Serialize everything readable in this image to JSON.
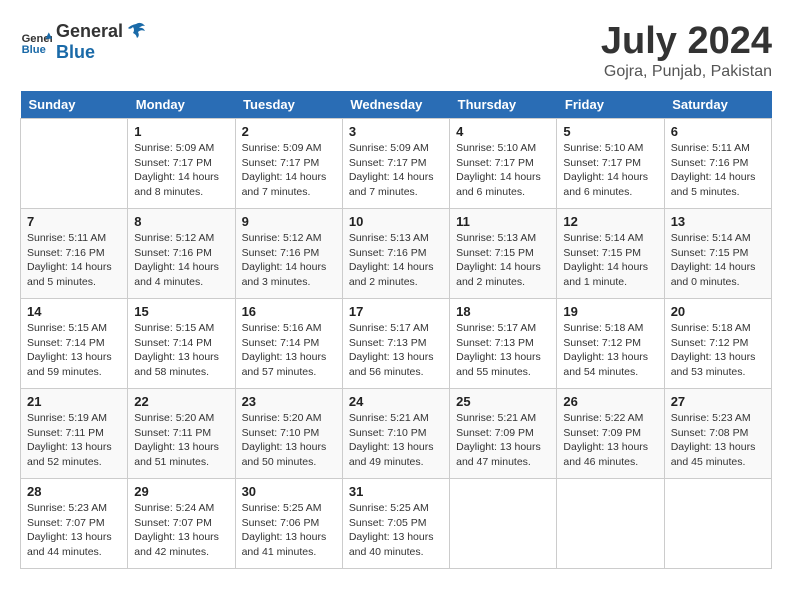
{
  "header": {
    "logo_general": "General",
    "logo_blue": "Blue",
    "title": "July 2024",
    "subtitle": "Gojra, Punjab, Pakistan"
  },
  "calendar": {
    "days_of_week": [
      "Sunday",
      "Monday",
      "Tuesday",
      "Wednesday",
      "Thursday",
      "Friday",
      "Saturday"
    ],
    "weeks": [
      [
        {
          "date": "",
          "info": ""
        },
        {
          "date": "1",
          "info": "Sunrise: 5:09 AM\nSunset: 7:17 PM\nDaylight: 14 hours\nand 8 minutes."
        },
        {
          "date": "2",
          "info": "Sunrise: 5:09 AM\nSunset: 7:17 PM\nDaylight: 14 hours\nand 7 minutes."
        },
        {
          "date": "3",
          "info": "Sunrise: 5:09 AM\nSunset: 7:17 PM\nDaylight: 14 hours\nand 7 minutes."
        },
        {
          "date": "4",
          "info": "Sunrise: 5:10 AM\nSunset: 7:17 PM\nDaylight: 14 hours\nand 6 minutes."
        },
        {
          "date": "5",
          "info": "Sunrise: 5:10 AM\nSunset: 7:17 PM\nDaylight: 14 hours\nand 6 minutes."
        },
        {
          "date": "6",
          "info": "Sunrise: 5:11 AM\nSunset: 7:16 PM\nDaylight: 14 hours\nand 5 minutes."
        }
      ],
      [
        {
          "date": "7",
          "info": "Sunrise: 5:11 AM\nSunset: 7:16 PM\nDaylight: 14 hours\nand 5 minutes."
        },
        {
          "date": "8",
          "info": "Sunrise: 5:12 AM\nSunset: 7:16 PM\nDaylight: 14 hours\nand 4 minutes."
        },
        {
          "date": "9",
          "info": "Sunrise: 5:12 AM\nSunset: 7:16 PM\nDaylight: 14 hours\nand 3 minutes."
        },
        {
          "date": "10",
          "info": "Sunrise: 5:13 AM\nSunset: 7:16 PM\nDaylight: 14 hours\nand 2 minutes."
        },
        {
          "date": "11",
          "info": "Sunrise: 5:13 AM\nSunset: 7:15 PM\nDaylight: 14 hours\nand 2 minutes."
        },
        {
          "date": "12",
          "info": "Sunrise: 5:14 AM\nSunset: 7:15 PM\nDaylight: 14 hours\nand 1 minute."
        },
        {
          "date": "13",
          "info": "Sunrise: 5:14 AM\nSunset: 7:15 PM\nDaylight: 14 hours\nand 0 minutes."
        }
      ],
      [
        {
          "date": "14",
          "info": "Sunrise: 5:15 AM\nSunset: 7:14 PM\nDaylight: 13 hours\nand 59 minutes."
        },
        {
          "date": "15",
          "info": "Sunrise: 5:15 AM\nSunset: 7:14 PM\nDaylight: 13 hours\nand 58 minutes."
        },
        {
          "date": "16",
          "info": "Sunrise: 5:16 AM\nSunset: 7:14 PM\nDaylight: 13 hours\nand 57 minutes."
        },
        {
          "date": "17",
          "info": "Sunrise: 5:17 AM\nSunset: 7:13 PM\nDaylight: 13 hours\nand 56 minutes."
        },
        {
          "date": "18",
          "info": "Sunrise: 5:17 AM\nSunset: 7:13 PM\nDaylight: 13 hours\nand 55 minutes."
        },
        {
          "date": "19",
          "info": "Sunrise: 5:18 AM\nSunset: 7:12 PM\nDaylight: 13 hours\nand 54 minutes."
        },
        {
          "date": "20",
          "info": "Sunrise: 5:18 AM\nSunset: 7:12 PM\nDaylight: 13 hours\nand 53 minutes."
        }
      ],
      [
        {
          "date": "21",
          "info": "Sunrise: 5:19 AM\nSunset: 7:11 PM\nDaylight: 13 hours\nand 52 minutes."
        },
        {
          "date": "22",
          "info": "Sunrise: 5:20 AM\nSunset: 7:11 PM\nDaylight: 13 hours\nand 51 minutes."
        },
        {
          "date": "23",
          "info": "Sunrise: 5:20 AM\nSunset: 7:10 PM\nDaylight: 13 hours\nand 50 minutes."
        },
        {
          "date": "24",
          "info": "Sunrise: 5:21 AM\nSunset: 7:10 PM\nDaylight: 13 hours\nand 49 minutes."
        },
        {
          "date": "25",
          "info": "Sunrise: 5:21 AM\nSunset: 7:09 PM\nDaylight: 13 hours\nand 47 minutes."
        },
        {
          "date": "26",
          "info": "Sunrise: 5:22 AM\nSunset: 7:09 PM\nDaylight: 13 hours\nand 46 minutes."
        },
        {
          "date": "27",
          "info": "Sunrise: 5:23 AM\nSunset: 7:08 PM\nDaylight: 13 hours\nand 45 minutes."
        }
      ],
      [
        {
          "date": "28",
          "info": "Sunrise: 5:23 AM\nSunset: 7:07 PM\nDaylight: 13 hours\nand 44 minutes."
        },
        {
          "date": "29",
          "info": "Sunrise: 5:24 AM\nSunset: 7:07 PM\nDaylight: 13 hours\nand 42 minutes."
        },
        {
          "date": "30",
          "info": "Sunrise: 5:25 AM\nSunset: 7:06 PM\nDaylight: 13 hours\nand 41 minutes."
        },
        {
          "date": "31",
          "info": "Sunrise: 5:25 AM\nSunset: 7:05 PM\nDaylight: 13 hours\nand 40 minutes."
        },
        {
          "date": "",
          "info": ""
        },
        {
          "date": "",
          "info": ""
        },
        {
          "date": "",
          "info": ""
        }
      ]
    ]
  }
}
